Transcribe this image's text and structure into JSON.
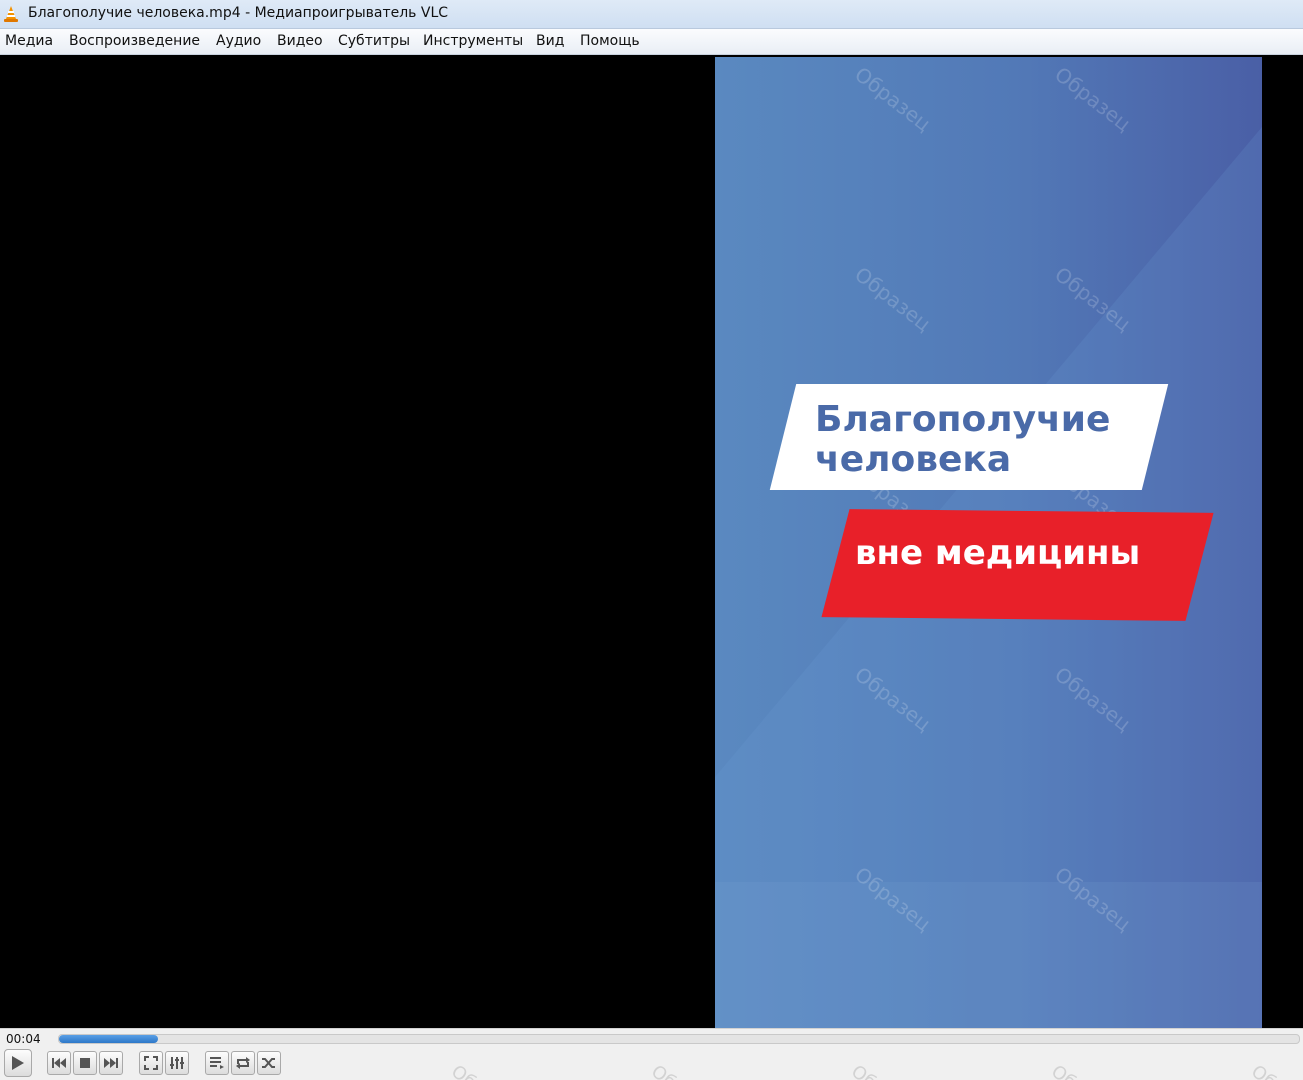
{
  "window": {
    "title": "Благополучие человека.mp4 - Медиапроигрыватель VLC",
    "icon": "vlc-cone-icon"
  },
  "menu": {
    "items": [
      "Медиа",
      "Воспроизведение",
      "Аудио",
      "Видео",
      "Субтитры",
      "Инструменты",
      "Вид",
      "Помощь"
    ]
  },
  "video": {
    "line1": "Благополучие",
    "line2": "человека",
    "line3": "вне медицины",
    "watermark": "Образец",
    "colors": {
      "background": "#5279b7",
      "title_text": "#4a6aa8",
      "red_banner": "#e82029"
    }
  },
  "controls": {
    "time": "00:04",
    "progress_fraction": 0.08,
    "buttons": [
      "play-icon",
      "previous-icon",
      "stop-icon",
      "next-icon",
      "fullscreen-icon",
      "extended-settings-icon",
      "playlist-icon",
      "loop-icon",
      "shuffle-icon"
    ]
  }
}
